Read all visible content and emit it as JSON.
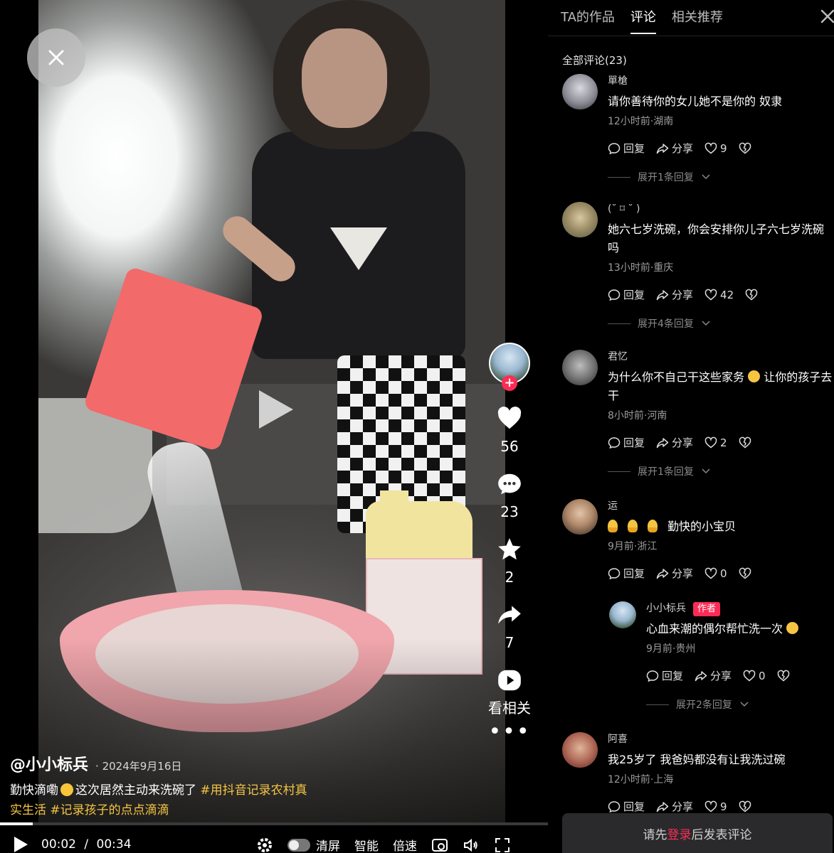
{
  "video": {
    "author": "@小小标兵",
    "date": "2024年9月16日",
    "desc_text_1": "勤快滴嘞",
    "desc_text_2": "这次居然主动来洗碗了",
    "hashtag_1": "#用抖音记录农村真实生活",
    "hashtag_2": "#记录孩子的点点滴滴",
    "progress_fraction": 0.06,
    "current_time": "00:02",
    "separator": "/",
    "duration": "00:34"
  },
  "rail": {
    "likes": "56",
    "comments": "23",
    "favorites": "2",
    "shares": "7",
    "related_label": "看相关",
    "more": "•••",
    "follow": "+"
  },
  "controls": {
    "clear_screen": "清屏",
    "smart": "智能",
    "speed": "倍速"
  },
  "panel": {
    "tabs": [
      "TA的作品",
      "评论",
      "相关推荐"
    ],
    "active_tab": "评论",
    "all_comments": "全部评论(23)",
    "reply_label": "回复",
    "share_label": "分享",
    "comments": [
      {
        "name": "單槍",
        "text": "请你善待你的女儿她不是你的 奴隶",
        "meta": "12小时前·湖南",
        "likes": "9",
        "expand": "展开1条回复"
      },
      {
        "name": "(˘ ⌑ ˘ )",
        "text": "她六七岁洗碗，你会安排你儿子六七岁洗碗吗",
        "meta": "13小时前·重庆",
        "likes": "42",
        "expand": "展开4条回复"
      },
      {
        "name": "君忆",
        "text_a": "为什么你不自己干这些家务",
        "text_b": "让你的孩子去干",
        "meta": "8小时前·河南",
        "likes": "2",
        "expand": "展开1条回复"
      },
      {
        "name": "运",
        "text": "勤快的小宝贝",
        "meta": "9月前·浙江",
        "likes": "0"
      },
      {
        "name": "阿喜",
        "text": "我25岁了 我爸妈都没有让我洗过碗",
        "meta": "12小时前·上海",
        "likes": "9"
      }
    ],
    "author_reply": {
      "name": "小小标兵",
      "badge": "作者",
      "text": "心血来潮的偶尔帮忙洗一次",
      "meta": "9月前·贵州",
      "likes": "0",
      "expand": "展开2条回复"
    },
    "login_prefix": "请先",
    "login_link": "登录",
    "login_suffix": "后发表评论"
  }
}
